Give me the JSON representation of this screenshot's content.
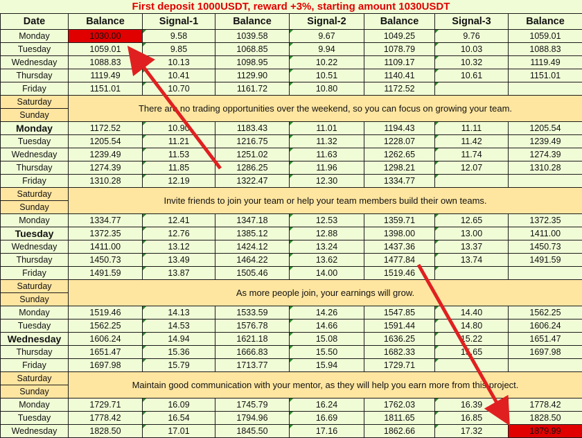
{
  "title": "First deposit 1000USDT, reward +3%, starting amount 1030USDT",
  "headers": [
    "Date",
    "Balance",
    "Signal-1",
    "Balance",
    "Signal-2",
    "Balance",
    "Signal-3",
    "Balance"
  ],
  "rows": [
    {
      "type": "data",
      "day": "Monday",
      "cells": [
        "1030.00",
        "9.58",
        "1039.58",
        "9.67",
        "1049.25",
        "9.76",
        "1059.01"
      ]
    },
    {
      "type": "data",
      "day": "Tuesday",
      "cells": [
        "1059.01",
        "9.85",
        "1068.85",
        "9.94",
        "1078.79",
        "10.03",
        "1088.83"
      ]
    },
    {
      "type": "data",
      "day": "Wednesday",
      "cells": [
        "1088.83",
        "10.13",
        "1098.95",
        "10.22",
        "1109.17",
        "10.32",
        "1119.49"
      ]
    },
    {
      "type": "data",
      "day": "Thursday",
      "cells": [
        "1119.49",
        "10.41",
        "1129.90",
        "10.51",
        "1140.41",
        "10.61",
        "1151.01"
      ]
    },
    {
      "type": "data",
      "day": "Friday",
      "cells": [
        "1151.01",
        "10.70",
        "1161.72",
        "10.80",
        "1172.52",
        "",
        ""
      ]
    },
    {
      "type": "weekend",
      "sat": "Saturday",
      "sun": "Sunday",
      "message": "There are no trading opportunities over the weekend, so you can focus on growing your team."
    },
    {
      "type": "data",
      "day": "Monday",
      "big": true,
      "cells": [
        "1172.52",
        "10.90",
        "1183.43",
        "11.01",
        "1194.43",
        "11.11",
        "1205.54"
      ]
    },
    {
      "type": "data",
      "day": "Tuesday",
      "cells": [
        "1205.54",
        "11.21",
        "1216.75",
        "11.32",
        "1228.07",
        "11.42",
        "1239.49"
      ]
    },
    {
      "type": "data",
      "day": "Wednesday",
      "cells": [
        "1239.49",
        "11.53",
        "1251.02",
        "11.63",
        "1262.65",
        "11.74",
        "1274.39"
      ]
    },
    {
      "type": "data",
      "day": "Thursday",
      "cells": [
        "1274.39",
        "11.85",
        "1286.25",
        "11.96",
        "1298.21",
        "12.07",
        "1310.28"
      ]
    },
    {
      "type": "data",
      "day": "Friday",
      "cells": [
        "1310.28",
        "12.19",
        "1322.47",
        "12.30",
        "1334.77",
        "",
        ""
      ]
    },
    {
      "type": "weekend",
      "sat": "Saturday",
      "sun": "Sunday",
      "message": "Invite friends to join your team or help your team members build their own teams."
    },
    {
      "type": "data",
      "day": "Monday",
      "cells": [
        "1334.77",
        "12.41",
        "1347.18",
        "12.53",
        "1359.71",
        "12.65",
        "1372.35"
      ]
    },
    {
      "type": "data",
      "day": "Tuesday",
      "big": true,
      "cells": [
        "1372.35",
        "12.76",
        "1385.12",
        "12.88",
        "1398.00",
        "13.00",
        "1411.00"
      ]
    },
    {
      "type": "data",
      "day": "Wednesday",
      "cells": [
        "1411.00",
        "13.12",
        "1424.12",
        "13.24",
        "1437.36",
        "13.37",
        "1450.73"
      ]
    },
    {
      "type": "data",
      "day": "Thursday",
      "cells": [
        "1450.73",
        "13.49",
        "1464.22",
        "13.62",
        "1477.84",
        "13.74",
        "1491.59"
      ]
    },
    {
      "type": "data",
      "day": "Friday",
      "cells": [
        "1491.59",
        "13.87",
        "1505.46",
        "14.00",
        "1519.46",
        "",
        ""
      ]
    },
    {
      "type": "weekend",
      "sat": "Saturday",
      "sun": "Sunday",
      "message": "As more people join, your earnings will grow."
    },
    {
      "type": "data",
      "day": "Monday",
      "cells": [
        "1519.46",
        "14.13",
        "1533.59",
        "14.26",
        "1547.85",
        "14.40",
        "1562.25"
      ]
    },
    {
      "type": "data",
      "day": "Tuesday",
      "cells": [
        "1562.25",
        "14.53",
        "1576.78",
        "14.66",
        "1591.44",
        "14.80",
        "1606.24"
      ]
    },
    {
      "type": "data",
      "day": "Wednesday",
      "big": true,
      "cells": [
        "1606.24",
        "14.94",
        "1621.18",
        "15.08",
        "1636.25",
        "15.22",
        "1651.47"
      ]
    },
    {
      "type": "data",
      "day": "Thursday",
      "cells": [
        "1651.47",
        "15.36",
        "1666.83",
        "15.50",
        "1682.33",
        "15.65",
        "1697.98"
      ]
    },
    {
      "type": "data",
      "day": "Friday",
      "cells": [
        "1697.98",
        "15.79",
        "1713.77",
        "15.94",
        "1729.71",
        "",
        ""
      ]
    },
    {
      "type": "weekend",
      "sat": "Saturday",
      "sun": "Sunday",
      "message": "Maintain good communication with your mentor, as they will help you earn more from this project."
    },
    {
      "type": "data",
      "day": "Monday",
      "cells": [
        "1729.71",
        "16.09",
        "1745.79",
        "16.24",
        "1762.03",
        "16.39",
        "1778.42"
      ]
    },
    {
      "type": "data",
      "day": "Tuesday",
      "cells": [
        "1778.42",
        "16.54",
        "1794.96",
        "16.69",
        "1811.65",
        "16.85",
        "1828.50"
      ]
    },
    {
      "type": "data",
      "day": "Wednesday",
      "cells": [
        "1828.50",
        "17.01",
        "1845.50",
        "17.16",
        "1862.66",
        "17.32",
        "1879.99"
      ]
    }
  ],
  "highlight_color": "#e00000",
  "arrow_color": "#e02020"
}
